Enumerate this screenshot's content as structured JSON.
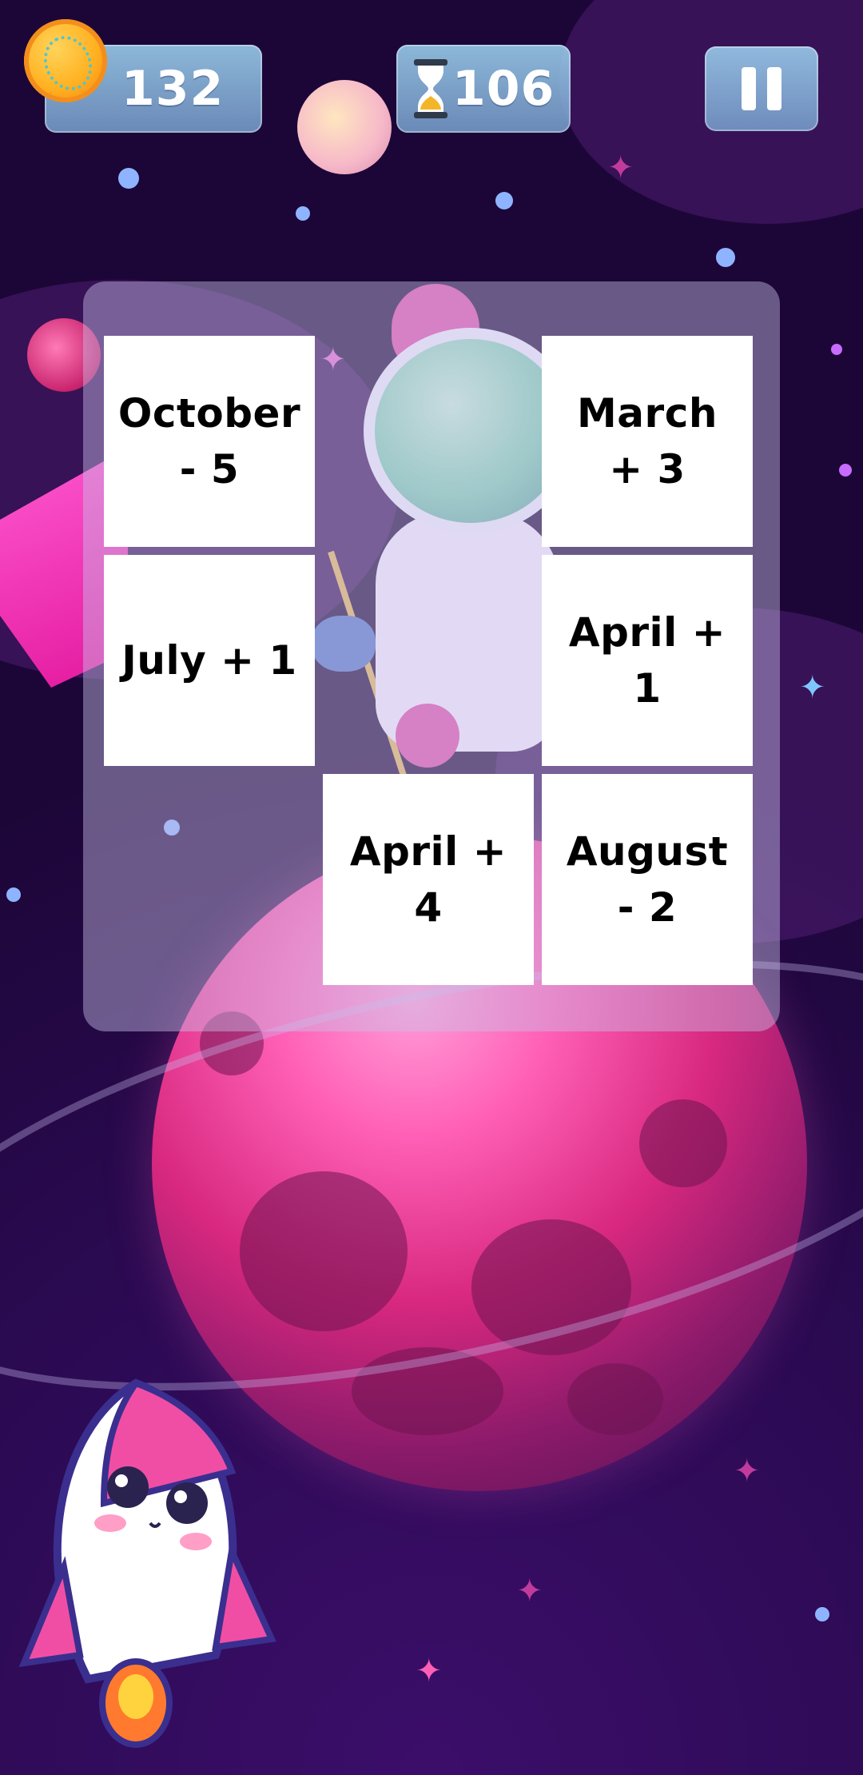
{
  "hud": {
    "coins": "132",
    "timer": "106"
  },
  "cards": [
    {
      "label": "October - 5"
    },
    {
      "label": "March + 3"
    },
    {
      "label": "July + 1"
    },
    {
      "label": "April + 1"
    },
    {
      "label": "April + 4"
    },
    {
      "label": "August - 2"
    }
  ],
  "icons": {
    "coin": "coin-icon",
    "timer": "hourglass-icon",
    "pause": "pause-icon"
  },
  "colors": {
    "background": "#2b0a52",
    "card": "#ffffff",
    "card_text": "#000000",
    "hud_box": "#8fc2e6",
    "planet": "#d8287f"
  }
}
